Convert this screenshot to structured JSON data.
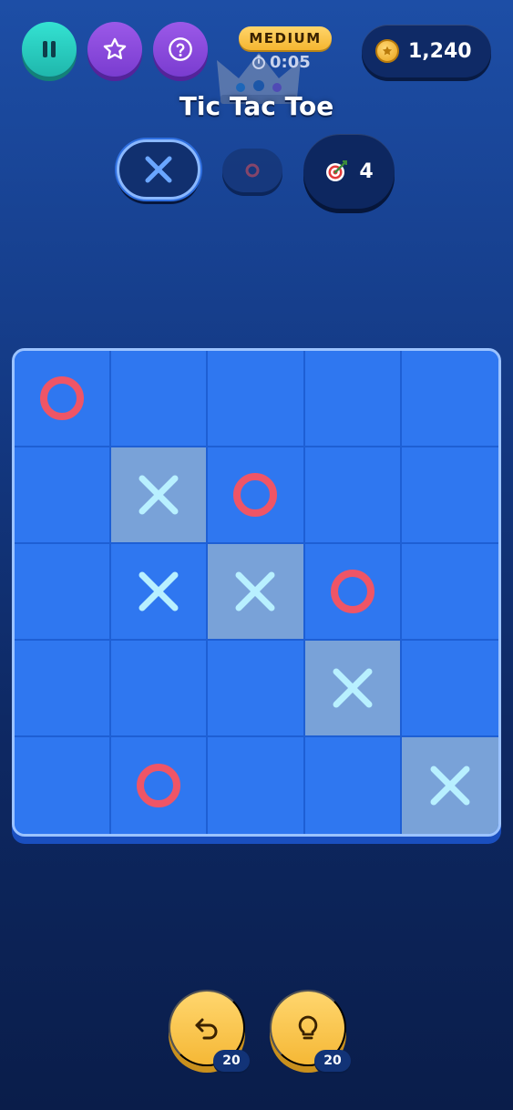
{
  "header": {
    "pause_icon": "pause-icon",
    "star_icon": "star-icon",
    "help_icon": "question-icon",
    "difficulty": "MEDIUM",
    "timer": "0:05",
    "coins": "1,240",
    "title": "Tic Tac Toe"
  },
  "turn": {
    "active_player": "X",
    "moves_remaining": "4"
  },
  "board": {
    "rows": 5,
    "cols": 5,
    "cells": [
      [
        "O",
        "",
        "",
        "",
        ""
      ],
      [
        "",
        "X",
        "O",
        "",
        ""
      ],
      [
        "",
        "X",
        "X",
        "O",
        ""
      ],
      [
        "",
        "",
        "",
        "X",
        ""
      ],
      [
        "",
        "O",
        "",
        "",
        "X"
      ]
    ],
    "winning_cells": [
      [
        1,
        1
      ],
      [
        2,
        2
      ],
      [
        3,
        3
      ],
      [
        4,
        4
      ]
    ]
  },
  "actions": {
    "undo_count": "20",
    "hint_count": "20"
  },
  "colors": {
    "x_mark": "#b8f0ff",
    "o_mark": "#ef5566",
    "board": "#2f77f0",
    "win_cell": "#79a2d8",
    "accent_gold": "#f5b836"
  }
}
